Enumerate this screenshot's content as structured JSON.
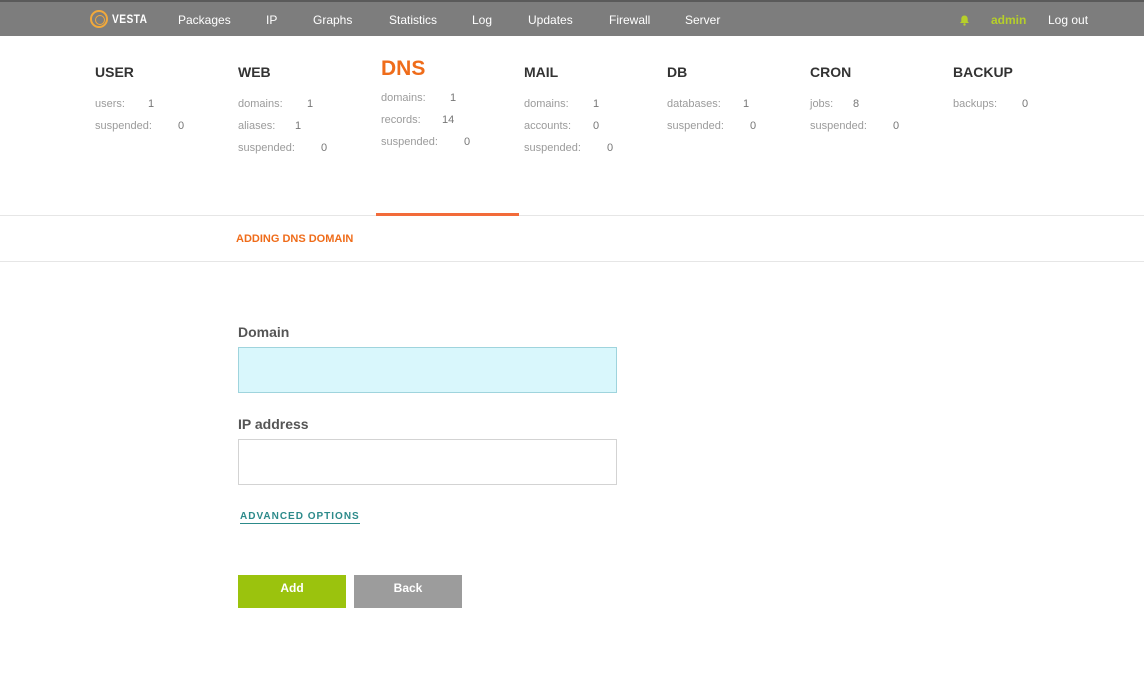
{
  "brand": {
    "logo_text": "VESTA"
  },
  "nav": {
    "items": [
      "Packages",
      "IP",
      "Graphs",
      "Statistics",
      "Log",
      "Updates",
      "Firewall",
      "Server"
    ],
    "user": "admin",
    "logout": "Log out"
  },
  "panels": [
    {
      "title": "USER",
      "stats": [
        {
          "label": "users:",
          "value": "1"
        },
        {
          "label": "suspended:",
          "value": "0"
        }
      ]
    },
    {
      "title": "WEB",
      "stats": [
        {
          "label": "domains:",
          "value": "1"
        },
        {
          "label": "aliases:",
          "value": "1"
        },
        {
          "label": "suspended:",
          "value": "0"
        }
      ]
    },
    {
      "title": "DNS",
      "stats": [
        {
          "label": "domains:",
          "value": "1"
        },
        {
          "label": "records:",
          "value": "14"
        },
        {
          "label": "suspended:",
          "value": "0"
        }
      ]
    },
    {
      "title": "MAIL",
      "stats": [
        {
          "label": "domains:",
          "value": "1"
        },
        {
          "label": "accounts:",
          "value": "0"
        },
        {
          "label": "suspended:",
          "value": "0"
        }
      ]
    },
    {
      "title": "DB",
      "stats": [
        {
          "label": "databases:",
          "value": "1"
        },
        {
          "label": "suspended:",
          "value": "0"
        }
      ]
    },
    {
      "title": "CRON",
      "stats": [
        {
          "label": "jobs:",
          "value": "8"
        },
        {
          "label": "suspended:",
          "value": "0"
        }
      ]
    },
    {
      "title": "BACKUP",
      "stats": [
        {
          "label": "backups:",
          "value": "0"
        }
      ]
    }
  ],
  "page": {
    "subheader": "ADDING DNS DOMAIN"
  },
  "form": {
    "domain_label": "Domain",
    "domain_value": "",
    "ip_label": "IP address",
    "ip_value": "",
    "advanced": "ADVANCED OPTIONS",
    "add": "Add",
    "back": "Back"
  },
  "colors": {
    "accent": "#ef6c1a",
    "add_button": "#9bc30d",
    "back_button": "#9c9c9c",
    "topbar": "#7d7d7d"
  }
}
